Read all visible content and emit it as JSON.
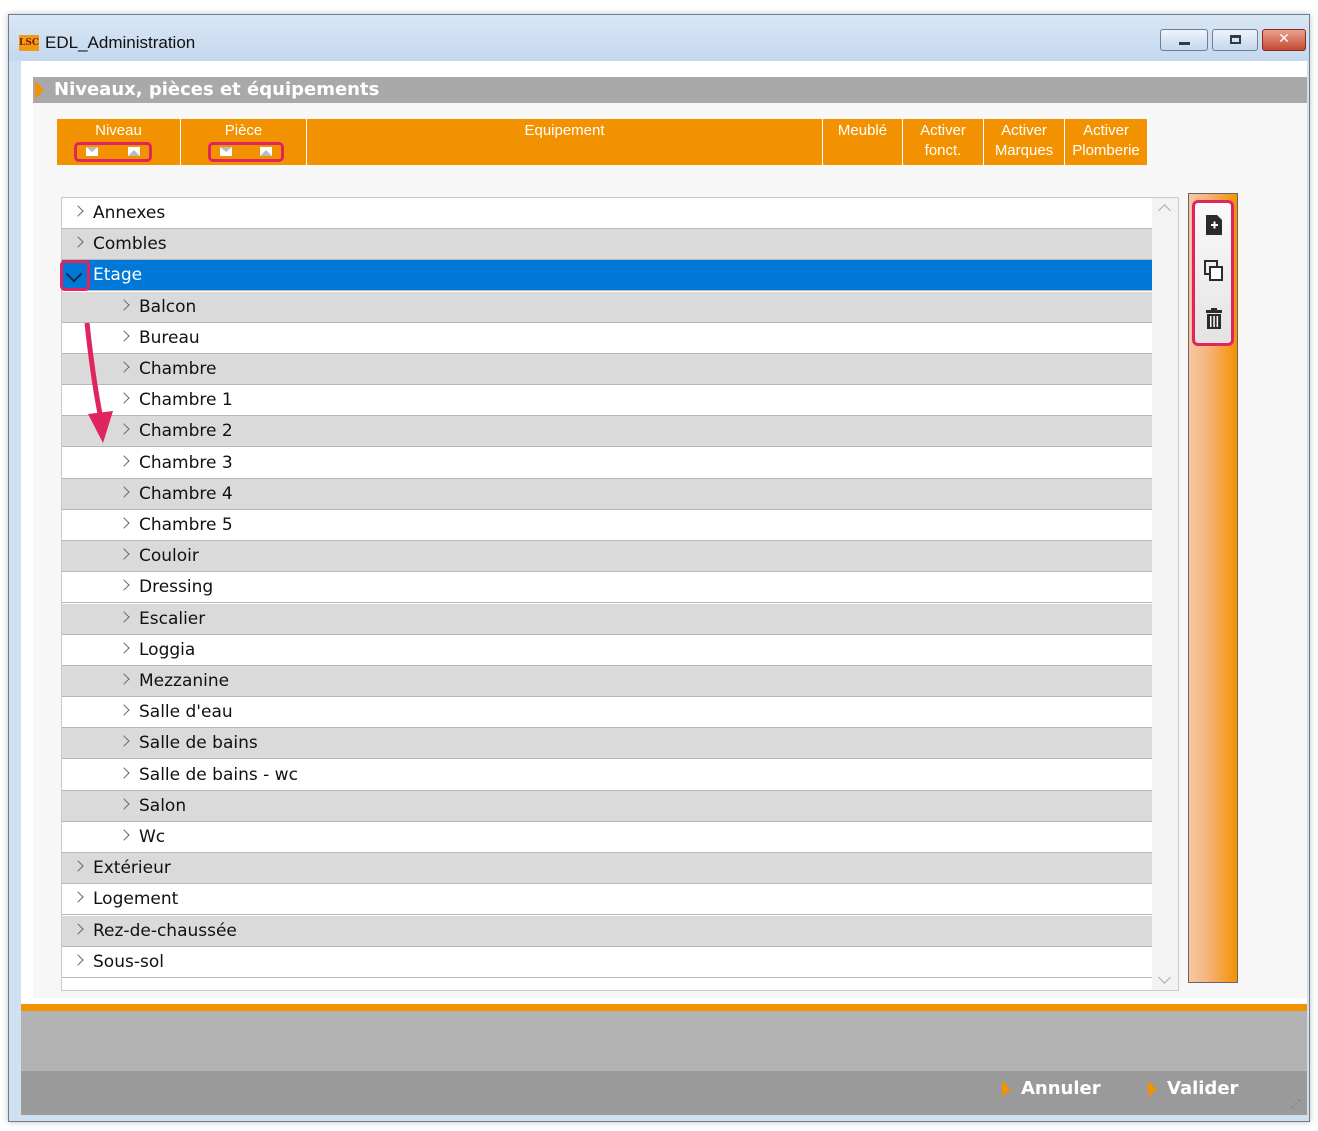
{
  "window": {
    "logo": "LSC",
    "title": "EDL_Administration",
    "controls": {
      "minimize": "minimize",
      "maximize": "maximize",
      "close": "✕"
    }
  },
  "section": {
    "title": "Niveaux, pièces et équipements"
  },
  "columns": [
    {
      "label": "Niveau"
    },
    {
      "label": "Pièce"
    },
    {
      "label": "Equipement"
    },
    {
      "label": "Meublé"
    },
    {
      "label": "Activer fonct."
    },
    {
      "label": "Activer Marques"
    },
    {
      "label": "Activer Plomberie"
    }
  ],
  "tree": {
    "rows": [
      {
        "label": "Annexes",
        "level": 0
      },
      {
        "label": "Combles",
        "level": 0
      },
      {
        "label": "Etage",
        "level": 0,
        "expanded": true,
        "selected": true
      },
      {
        "label": "Balcon",
        "level": 1
      },
      {
        "label": "Bureau",
        "level": 1
      },
      {
        "label": "Chambre",
        "level": 1
      },
      {
        "label": "Chambre 1",
        "level": 1
      },
      {
        "label": "Chambre 2",
        "level": 1
      },
      {
        "label": "Chambre 3",
        "level": 1
      },
      {
        "label": "Chambre 4",
        "level": 1
      },
      {
        "label": "Chambre 5",
        "level": 1
      },
      {
        "label": "Couloir",
        "level": 1
      },
      {
        "label": "Dressing",
        "level": 1
      },
      {
        "label": "Escalier",
        "level": 1
      },
      {
        "label": "Loggia",
        "level": 1
      },
      {
        "label": "Mezzanine",
        "level": 1
      },
      {
        "label": "Salle d'eau",
        "level": 1
      },
      {
        "label": "Salle de bains",
        "level": 1
      },
      {
        "label": "Salle de bains - wc",
        "level": 1
      },
      {
        "label": "Salon",
        "level": 1
      },
      {
        "label": "Wc",
        "level": 1
      },
      {
        "label": "Extérieur",
        "level": 0
      },
      {
        "label": "Logement",
        "level": 0
      },
      {
        "label": "Rez-de-chaussée",
        "level": 0
      },
      {
        "label": "Sous-sol",
        "level": 0
      }
    ]
  },
  "toolbar": {
    "icons": [
      "add-icon",
      "duplicate-icon",
      "delete-icon"
    ]
  },
  "footer": {
    "cancel": "Annuler",
    "validate": "Valider"
  },
  "colors": {
    "accent": "#f39200",
    "highlight": "#e0245e",
    "selection": "#0078d7",
    "header_gray": "#a9a9a9"
  }
}
